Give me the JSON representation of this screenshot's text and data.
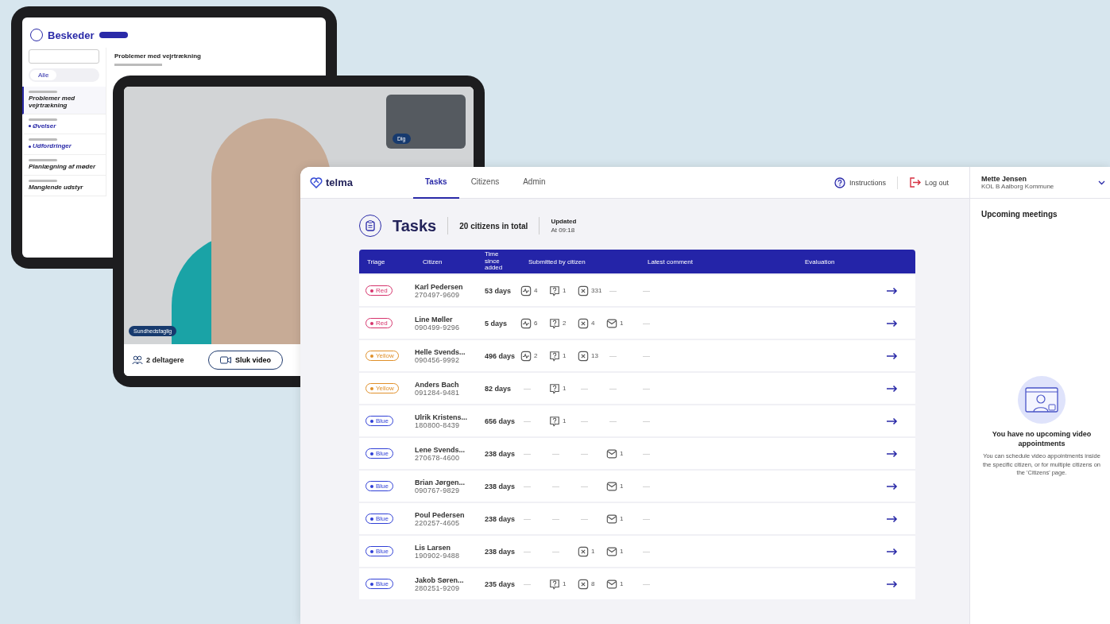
{
  "messages_tablet": {
    "title": "Beskeder",
    "filter_tabs": [
      {
        "label": "Alle",
        "selected": true
      }
    ],
    "threads": [
      {
        "title": "Problemer med vejrtrækning",
        "selected": true,
        "unread": false
      },
      {
        "title": "Øvelser",
        "selected": false,
        "unread": true
      },
      {
        "title": "Udfordringer",
        "selected": false,
        "unread": true
      },
      {
        "title": "Planlægning af møder",
        "selected": false,
        "unread": false
      },
      {
        "title": "Manglende udstyr",
        "selected": false,
        "unread": false
      }
    ],
    "conversation": {
      "title": "Problemer med vejrtrækning"
    }
  },
  "video_tablet": {
    "self_label": "Dig",
    "participant_label": "Sundhedsfaglig",
    "participants": "2 deltagere",
    "video_button": "Sluk video"
  },
  "app": {
    "logo": "telma",
    "tabs": [
      {
        "label": "Tasks",
        "selected": true
      },
      {
        "label": "Citizens",
        "selected": false
      },
      {
        "label": "Admin",
        "selected": false
      }
    ],
    "instructions": "Instructions",
    "logout": "Log out",
    "user": {
      "name": "Mette Jensen",
      "org": "KOL B Aalborg Kommune"
    },
    "page": {
      "title": "Tasks",
      "total": "20 citizens in total",
      "updated_label": "Updated",
      "updated_time": "At 09:18"
    },
    "table": {
      "columns": [
        "Triage",
        "Citizen",
        "Time since added",
        "Submitted by citizen",
        "Latest comment",
        "Evaluation"
      ],
      "rows": [
        {
          "triage": {
            "label": "Red",
            "color": "#d6336c"
          },
          "name": "Karl Pedersen",
          "cpr": "270497-9609",
          "time": "53 days",
          "submitted": [
            {
              "kind": "measurement",
              "count": "4"
            },
            {
              "kind": "question",
              "count": "1"
            },
            {
              "kind": "cancelled",
              "count": "331"
            },
            {
              "kind": "empty",
              "text": "—"
            }
          ],
          "latest_comment": "—"
        },
        {
          "triage": {
            "label": "Red",
            "color": "#d6336c"
          },
          "name": "Line Møller",
          "cpr": "090499-9296",
          "time": "5 days",
          "submitted": [
            {
              "kind": "measurement",
              "count": "6"
            },
            {
              "kind": "question",
              "count": "2"
            },
            {
              "kind": "cancelled",
              "count": "4"
            },
            {
              "kind": "message",
              "count": "1"
            }
          ],
          "latest_comment": "—"
        },
        {
          "triage": {
            "label": "Yellow",
            "color": "#e0902a"
          },
          "name": "Helle Svends...",
          "cpr": "090456-9992",
          "time": "496 days",
          "submitted": [
            {
              "kind": "measurement",
              "count": "2"
            },
            {
              "kind": "question",
              "count": "1"
            },
            {
              "kind": "cancelled",
              "count": "13"
            },
            {
              "kind": "empty",
              "text": "—"
            }
          ],
          "latest_comment": "—"
        },
        {
          "triage": {
            "label": "Yellow",
            "color": "#e0902a"
          },
          "name": "Anders Bach",
          "cpr": "091284-9481",
          "time": "82 days",
          "submitted": [
            {
              "kind": "empty",
              "text": "—"
            },
            {
              "kind": "question",
              "count": "1"
            },
            {
              "kind": "empty",
              "text": "—"
            },
            {
              "kind": "empty",
              "text": "—"
            }
          ],
          "latest_comment": "—"
        },
        {
          "triage": {
            "label": "Blue",
            "color": "#2f3fd6"
          },
          "name": "Ulrik Kristens...",
          "cpr": "180800-8439",
          "time": "656 days",
          "submitted": [
            {
              "kind": "empty",
              "text": "—"
            },
            {
              "kind": "question",
              "count": "1"
            },
            {
              "kind": "empty",
              "text": "—"
            },
            {
              "kind": "empty",
              "text": "—"
            }
          ],
          "latest_comment": "—"
        },
        {
          "triage": {
            "label": "Blue",
            "color": "#2f3fd6"
          },
          "name": "Lene Svends...",
          "cpr": "270678-4600",
          "time": "238 days",
          "submitted": [
            {
              "kind": "empty",
              "text": "—"
            },
            {
              "kind": "empty",
              "text": "—"
            },
            {
              "kind": "empty",
              "text": "—"
            },
            {
              "kind": "message",
              "count": "1"
            }
          ],
          "latest_comment": "—"
        },
        {
          "triage": {
            "label": "Blue",
            "color": "#2f3fd6"
          },
          "name": "Brian Jørgen...",
          "cpr": "090767-9829",
          "time": "238 days",
          "submitted": [
            {
              "kind": "empty",
              "text": "—"
            },
            {
              "kind": "empty",
              "text": "—"
            },
            {
              "kind": "empty",
              "text": "—"
            },
            {
              "kind": "message",
              "count": "1"
            }
          ],
          "latest_comment": "—"
        },
        {
          "triage": {
            "label": "Blue",
            "color": "#2f3fd6"
          },
          "name": "Poul Pedersen",
          "cpr": "220257-4605",
          "time": "238 days",
          "submitted": [
            {
              "kind": "empty",
              "text": "—"
            },
            {
              "kind": "empty",
              "text": "—"
            },
            {
              "kind": "empty",
              "text": "—"
            },
            {
              "kind": "message",
              "count": "1"
            }
          ],
          "latest_comment": "—"
        },
        {
          "triage": {
            "label": "Blue",
            "color": "#2f3fd6"
          },
          "name": "Lis Larsen",
          "cpr": "190902-9488",
          "time": "238 days",
          "submitted": [
            {
              "kind": "empty",
              "text": "—"
            },
            {
              "kind": "empty",
              "text": "—"
            },
            {
              "kind": "cancelled",
              "count": "1"
            },
            {
              "kind": "message",
              "count": "1"
            }
          ],
          "latest_comment": "—"
        },
        {
          "triage": {
            "label": "Blue",
            "color": "#2f3fd6"
          },
          "name": "Jakob Søren...",
          "cpr": "280251-9209",
          "time": "235 days",
          "submitted": [
            {
              "kind": "empty",
              "text": "—"
            },
            {
              "kind": "question",
              "count": "1"
            },
            {
              "kind": "cancelled",
              "count": "8"
            },
            {
              "kind": "message",
              "count": "1"
            }
          ],
          "latest_comment": "—"
        }
      ]
    },
    "upcoming": {
      "title": "Upcoming meetings",
      "empty_title": "You have no upcoming video appointments",
      "empty_text": "You can schedule video appointments inside the specific citizen, or for multiple citizens on the 'Citizens' page."
    }
  }
}
